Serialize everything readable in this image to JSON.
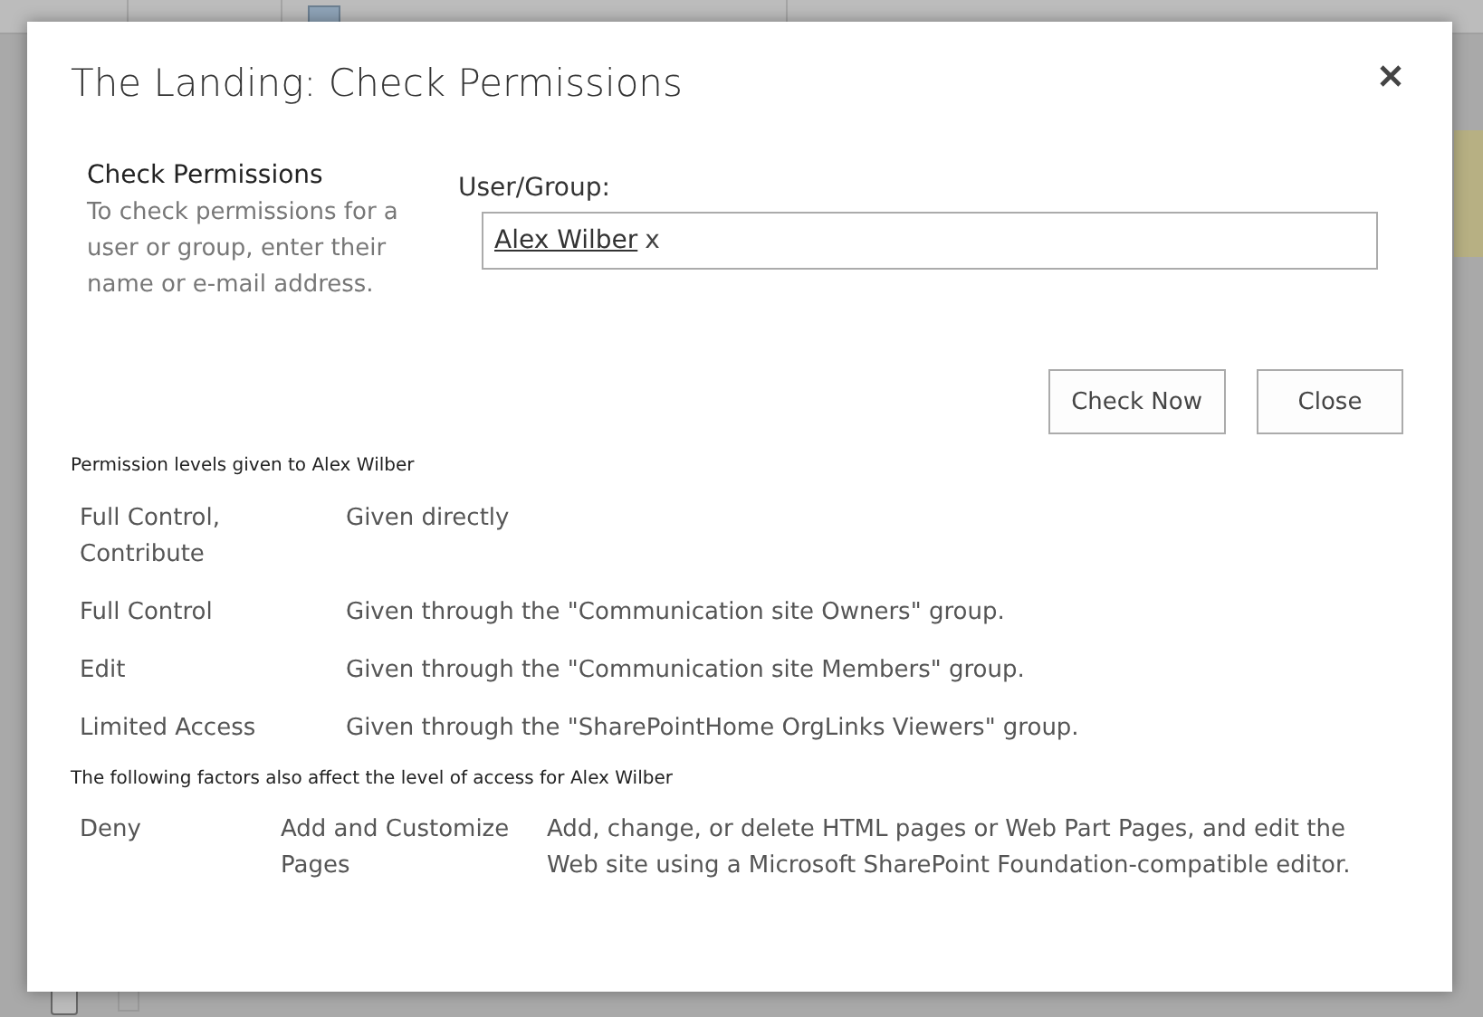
{
  "background": {
    "row": {
      "checked": false
    }
  },
  "dialog": {
    "title": "The Landing: Check Permissions",
    "section": {
      "heading": "Check Permissions",
      "description": "To check permissions for a user or group, enter their name or e-mail address."
    },
    "field": {
      "label": "User/Group:",
      "value": "Alex Wilber",
      "remove": "x"
    },
    "buttons": [
      "Check Now",
      "Close"
    ],
    "levels_heading": "Permission levels given to Alex Wilber",
    "levels": [
      {
        "level": "Full Control, Contribute",
        "source": "Given directly"
      },
      {
        "level": "Full Control",
        "source": "Given through the \"Communication site Owners\" group."
      },
      {
        "level": "Edit",
        "source": "Given through the \"Communication site Members\" group."
      },
      {
        "level": "Limited Access",
        "source": "Given through the \"SharePointHome OrgLinks Viewers\" group."
      }
    ],
    "factors_heading": "The following factors also affect the level of access for Alex Wilber",
    "factors": [
      {
        "type": "Deny",
        "permission": "Add and Customize Pages",
        "description": "Add, change, or delete HTML pages or Web Part Pages, and edit the Web site using a Microsoft SharePoint Foundation-compatible editor."
      }
    ]
  }
}
